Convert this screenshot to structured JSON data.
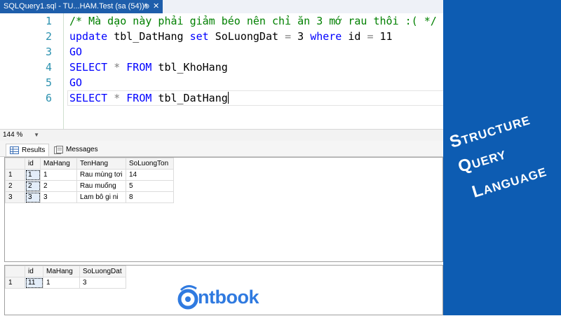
{
  "tab": {
    "title": "SQLQuery1.sql - TU...HAM.Test (sa (54))*",
    "pin_glyph": "⊕",
    "close_glyph": "✕"
  },
  "editor": {
    "lines": [
      {
        "num": "1",
        "parts": [
          {
            "cls": "cm",
            "text": "/* Mà dạo này phải giảm béo nên chỉ ăn 3 mớ rau thôi :( */"
          }
        ]
      },
      {
        "num": "2",
        "parts": [
          {
            "cls": "kw",
            "text": "update"
          },
          {
            "cls": "tx",
            "text": " tbl_DatHang "
          },
          {
            "cls": "kw",
            "text": "set"
          },
          {
            "cls": "tx",
            "text": " SoLuongDat "
          },
          {
            "cls": "gy",
            "text": "="
          },
          {
            "cls": "tx",
            "text": " 3 "
          },
          {
            "cls": "kw",
            "text": "where"
          },
          {
            "cls": "tx",
            "text": " id "
          },
          {
            "cls": "gy",
            "text": "="
          },
          {
            "cls": "tx",
            "text": " 11"
          }
        ]
      },
      {
        "num": "3",
        "parts": [
          {
            "cls": "kw",
            "text": "GO"
          }
        ]
      },
      {
        "num": "4",
        "parts": [
          {
            "cls": "kw",
            "text": "SELECT"
          },
          {
            "cls": "tx",
            "text": " "
          },
          {
            "cls": "gy",
            "text": "*"
          },
          {
            "cls": "tx",
            "text": " "
          },
          {
            "cls": "kw",
            "text": "FROM"
          },
          {
            "cls": "tx",
            "text": " tbl_KhoHang"
          }
        ]
      },
      {
        "num": "5",
        "parts": [
          {
            "cls": "kw",
            "text": "GO"
          }
        ]
      },
      {
        "num": "6",
        "parts": [
          {
            "cls": "kw",
            "text": "SELECT"
          },
          {
            "cls": "tx",
            "text": " "
          },
          {
            "cls": "gy",
            "text": "*"
          },
          {
            "cls": "tx",
            "text": " "
          },
          {
            "cls": "kw",
            "text": "FROM"
          },
          {
            "cls": "tx",
            "text": " tbl_DatHang"
          }
        ]
      }
    ]
  },
  "zoom": {
    "value": "144 %"
  },
  "results_tabs": {
    "results": "Results",
    "messages": "Messages"
  },
  "grid1": {
    "headers": [
      "id",
      "MaHang",
      "TenHang",
      "SoLuongTon"
    ],
    "rows": [
      {
        "num": "1",
        "cells": [
          "1",
          "1",
          "Rau mùng tơi",
          "14"
        ]
      },
      {
        "num": "2",
        "cells": [
          "2",
          "2",
          "Rau muống",
          "5"
        ]
      },
      {
        "num": "3",
        "cells": [
          "3",
          "3",
          "Lam bô gi ni",
          "8"
        ]
      }
    ]
  },
  "grid2": {
    "headers": [
      "id",
      "MaHang",
      "SoLuongDat"
    ],
    "rows": [
      {
        "num": "1",
        "cells": [
          "11",
          "1",
          "3"
        ]
      }
    ]
  },
  "sidebar": {
    "words": [
      {
        "big": "S",
        "rest": "TRUCTURE"
      },
      {
        "big": "Q",
        "rest": "UERY"
      },
      {
        "big": "L",
        "rest": "ANGUAGE"
      }
    ]
  },
  "logo": {
    "text": "ntbook"
  },
  "colors": {
    "tab_active": "#1e5eab",
    "sidebar": "#0d5cb2",
    "keyword": "#0000ff",
    "comment": "#008000",
    "line_number": "#2b91af",
    "logo": "#2f7ae0"
  }
}
